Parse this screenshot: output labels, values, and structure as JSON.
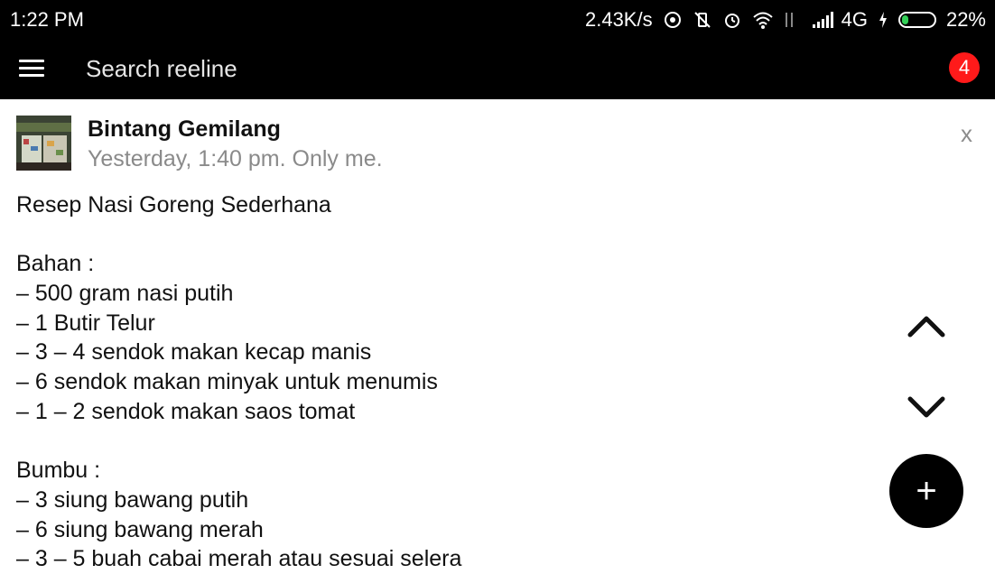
{
  "status_bar": {
    "time": "1:22 PM",
    "speed": "2.43K/s",
    "network": "4G",
    "battery": "22%",
    "battery_level": 0.22,
    "icons": [
      "hotspot-icon",
      "vibrate-off-icon",
      "alarm-icon",
      "wifi-icon",
      "data-arrows-icon",
      "signal-icon",
      "charging-icon",
      "battery-icon"
    ]
  },
  "app_bar": {
    "search_placeholder": "Search reeline",
    "notification_count": "4",
    "badge_color": "#ff1a1a"
  },
  "post": {
    "author": "Bintang Gemilang",
    "meta": "Yesterday, 1:40 pm. Only me.",
    "close_label": "x",
    "lines": [
      "Resep Nasi Goreng Sederhana",
      "",
      "Bahan :",
      "– 500 gram nasi putih",
      "– 1 Butir Telur",
      "– 3 – 4 sendok makan kecap manis",
      "– 6 sendok makan minyak untuk menumis",
      "– 1 – 2 sendok makan saos tomat",
      "",
      "Bumbu :",
      "– 3 siung bawang putih",
      "– 6 siung bawang merah",
      "– 3 – 5 buah cabai merah atau sesuai selera"
    ]
  },
  "controls": {
    "fab_label": "+"
  }
}
